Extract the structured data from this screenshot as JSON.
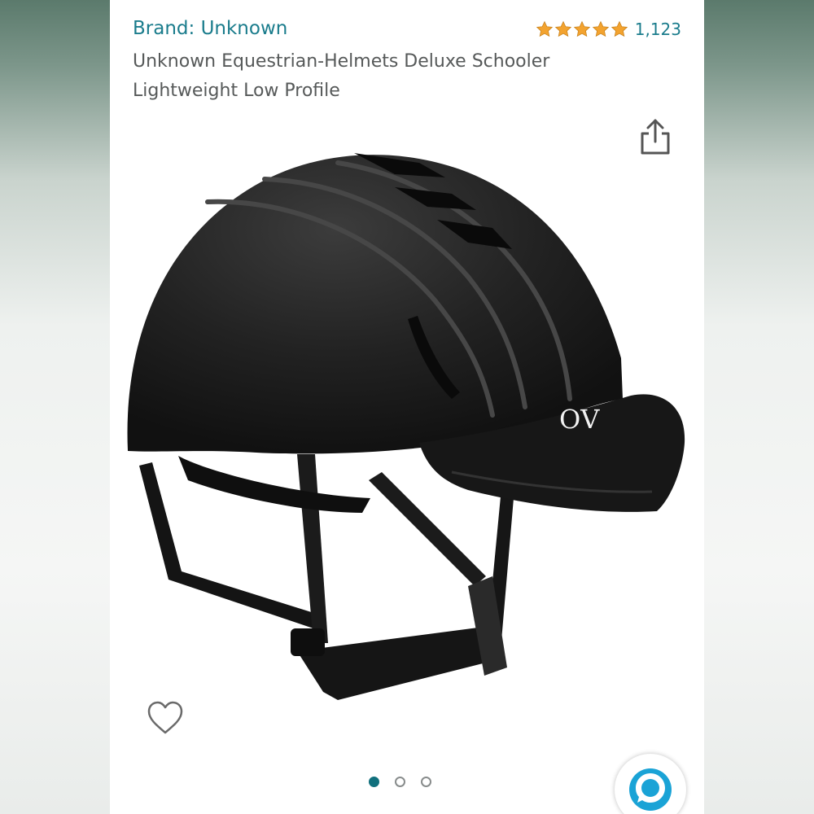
{
  "header": {
    "brand": "Brand: Unknown",
    "rating_stars": 5,
    "rating_count": "1,123",
    "title": "Unknown Equestrian-Helmets Deluxe Schooler Lightweight Low Profile"
  },
  "product_image": {
    "logo_text": "ΟV"
  },
  "carousel": {
    "total": 3,
    "active_index": 0
  },
  "colors": {
    "link": "#1a7c8c",
    "star": "#f3a32f",
    "title_text": "#565959",
    "active_dot": "#11707d",
    "alexa_blue": "#1aa3d6"
  },
  "icons": {
    "share": "share-icon",
    "wishlist": "heart-outline-icon",
    "alexa": "alexa-icon"
  }
}
